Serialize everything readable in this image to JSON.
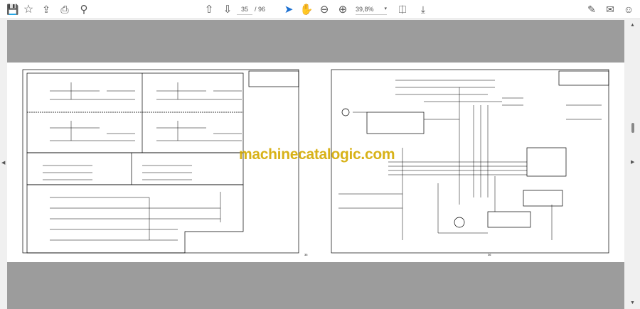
{
  "toolbar": {
    "left_icons": [
      "save-icon",
      "bookmark-star-icon",
      "upload-cloud-icon",
      "print-icon",
      "zoom-search-icon"
    ],
    "prev_page_icon": "arrow-up-circle-icon",
    "next_page_icon": "arrow-down-circle-icon",
    "current_page": "35",
    "total_pages": "/ 96",
    "tools": [
      "select-cursor-icon",
      "hand-icon",
      "zoom-out-icon",
      "zoom-in-icon"
    ],
    "zoom_level": "39,8%",
    "right_icons": [
      "fit-page-icon",
      "scroll-mode-icon",
      "sign-icon",
      "email-icon",
      "account-icon"
    ],
    "accent": "#1a6fd1"
  },
  "document": {
    "left_page_number": "35",
    "right_page_number": "36",
    "watermark": "machinecatalogic.com",
    "watermark_color": "#d4aa00"
  }
}
